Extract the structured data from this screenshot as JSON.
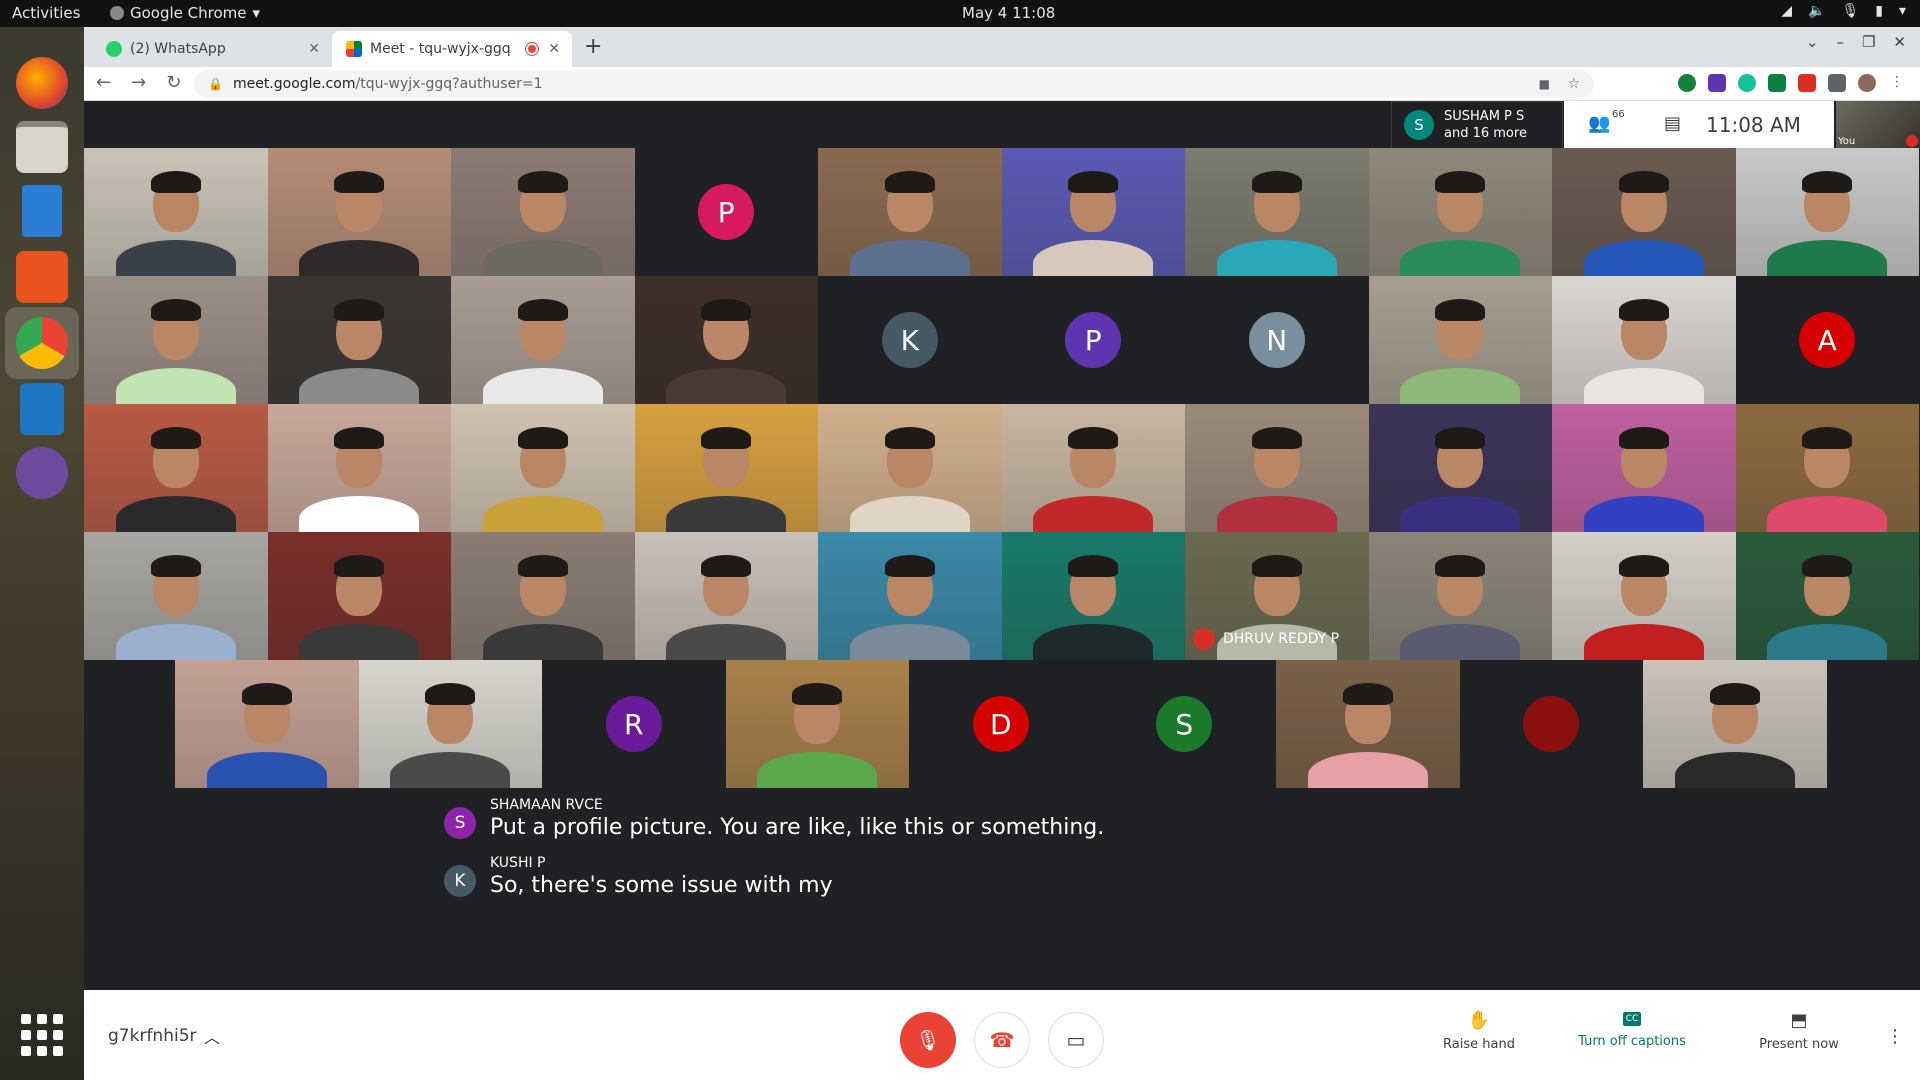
{
  "system": {
    "activities": "Activities",
    "app_name": "Google Chrome",
    "clock": "May 4  11:08"
  },
  "browser": {
    "tabs": [
      {
        "label": "(2) WhatsApp"
      },
      {
        "label": "Meet - tqu-wyjx-ggq"
      }
    ],
    "url_host": "meet.google.com",
    "url_path": "/tqu-wyjx-ggq?authuser=1"
  },
  "meet": {
    "people_summary": {
      "avatar_letter": "S",
      "name": "SUSHAM P S",
      "more": "and 16 more"
    },
    "participant_count": "66",
    "time": "11:08  AM",
    "self_label": "You",
    "tiles": [
      {
        "kind": "video",
        "bg": "#c9c3b6",
        "shirt": "#3a4048"
      },
      {
        "kind": "video",
        "bg": "#b58c76",
        "shirt": "#2f2a2a"
      },
      {
        "kind": "video",
        "bg": "#8c7b73",
        "shirt": "#6c6a5f"
      },
      {
        "kind": "avatar",
        "letter": "P",
        "color": "#d81b60"
      },
      {
        "kind": "video",
        "bg": "#8a6a4f",
        "shirt": "#5b6f8f"
      },
      {
        "kind": "video",
        "bg": "#5a5ab4",
        "shirt": "#d8c8bc"
      },
      {
        "kind": "video",
        "bg": "#7a7a6e",
        "shirt": "#2aa8b8"
      },
      {
        "kind": "video",
        "bg": "#8e8878",
        "shirt": "#2b8a5a"
      },
      {
        "kind": "video",
        "bg": "#6a5a50",
        "shirt": "#2558b8"
      },
      {
        "kind": "video",
        "bg": "#c8c8c8",
        "shirt": "#1f7a4a"
      },
      {
        "kind": "video",
        "bg": "#9b8e85",
        "shirt": "#c2e3b2"
      },
      {
        "kind": "video",
        "bg": "#3a3633",
        "shirt": "#8a8a8a"
      },
      {
        "kind": "video",
        "bg": "#a89c92",
        "shirt": "#e8e8e8"
      },
      {
        "kind": "video",
        "bg": "#3e2e28",
        "shirt": "#4a3a36"
      },
      {
        "kind": "avatar",
        "letter": "K",
        "color": "#455a64"
      },
      {
        "kind": "avatar",
        "letter": "P",
        "color": "#5e35b1"
      },
      {
        "kind": "avatar",
        "letter": "N",
        "color": "#78909c"
      },
      {
        "kind": "video",
        "bg": "#a69e8e",
        "shirt": "#8db87a"
      },
      {
        "kind": "video",
        "bg": "#dad6d2",
        "shirt": "#e8e4e0"
      },
      {
        "kind": "avatar",
        "letter": "A",
        "color": "#d50000"
      },
      {
        "kind": "video",
        "bg": "#b85a44",
        "shirt": "#2a2a2a"
      },
      {
        "kind": "video",
        "bg": "#c8a89a",
        "shirt": "#ffffff"
      },
      {
        "kind": "video",
        "bg": "#d0c2b0",
        "shirt": "#caa23a"
      },
      {
        "kind": "video",
        "bg": "#d8a040",
        "shirt": "#3a3a3a"
      },
      {
        "kind": "video",
        "bg": "#d2b08c",
        "shirt": "#e0d4c4"
      },
      {
        "kind": "video",
        "bg": "#c8b6a2",
        "shirt": "#c0282a"
      },
      {
        "kind": "video",
        "bg": "#9a8a7a",
        "shirt": "#b03040"
      },
      {
        "kind": "video",
        "bg": "#3c3458",
        "shirt": "#3a3080"
      },
      {
        "kind": "video",
        "bg": "#c060a0",
        "shirt": "#3040c0"
      },
      {
        "kind": "video",
        "bg": "#8c6a40",
        "shirt": "#e04a6a"
      },
      {
        "kind": "video",
        "bg": "#a8a6a2",
        "shirt": "#9aaed0"
      },
      {
        "kind": "video",
        "bg": "#7a2e2a",
        "shirt": "#3a3a3a"
      },
      {
        "kind": "video",
        "bg": "#8a7c72",
        "shirt": "#3a3a3a"
      },
      {
        "kind": "video",
        "bg": "#c8c0b8",
        "shirt": "#4a4a4a"
      },
      {
        "kind": "video",
        "bg": "#3a8aa8",
        "shirt": "#7a8a9a"
      },
      {
        "kind": "video",
        "bg": "#1a7a6a",
        "shirt": "#1e2a2a"
      },
      {
        "kind": "video",
        "bg": "#6a6a50",
        "shirt": "#b8b8a8",
        "name": "DHRUV REDDY P",
        "muted": true
      },
      {
        "kind": "video",
        "bg": "#8a8478",
        "shirt": "#5a5a70"
      },
      {
        "kind": "video",
        "bg": "#d4d0c8",
        "shirt": "#c02020"
      },
      {
        "kind": "video",
        "bg": "#2a5a3a",
        "shirt": "#2a7a8a"
      },
      {
        "kind": "video",
        "bg": "#c4a094",
        "shirt": "#2a52b0"
      },
      {
        "kind": "video",
        "bg": "#d6d4cc",
        "shirt": "#4a4a4a"
      },
      {
        "kind": "avatar",
        "letter": "R",
        "color": "#6a1b9a"
      },
      {
        "kind": "video",
        "bg": "#a8804a",
        "shirt": "#5aa84a"
      },
      {
        "kind": "avatar",
        "letter": "D",
        "color": "#d50000"
      },
      {
        "kind": "avatar",
        "letter": "S",
        "color": "#1b7a2a"
      },
      {
        "kind": "video",
        "bg": "#7a6048",
        "shirt": "#e8a0a8"
      },
      {
        "kind": "avatar",
        "letter": "",
        "color": "#8a1010"
      },
      {
        "kind": "video",
        "bg": "#c8c2b8",
        "shirt": "#2a2a2a"
      }
    ]
  },
  "captions": [
    {
      "letter": "S",
      "color": "#8e24aa",
      "name": "SHAMAAN RVCE",
      "text": "Put a profile picture. You are like, like this or something."
    },
    {
      "letter": "K",
      "color": "#455a64",
      "name": "KUSHI P",
      "text": "So, there's some issue with my"
    }
  ],
  "bottom": {
    "meeting_code": "g7krfnhi5r",
    "raise_hand": "Raise hand",
    "captions_label": "Turn off captions",
    "present_label": "Present now"
  }
}
